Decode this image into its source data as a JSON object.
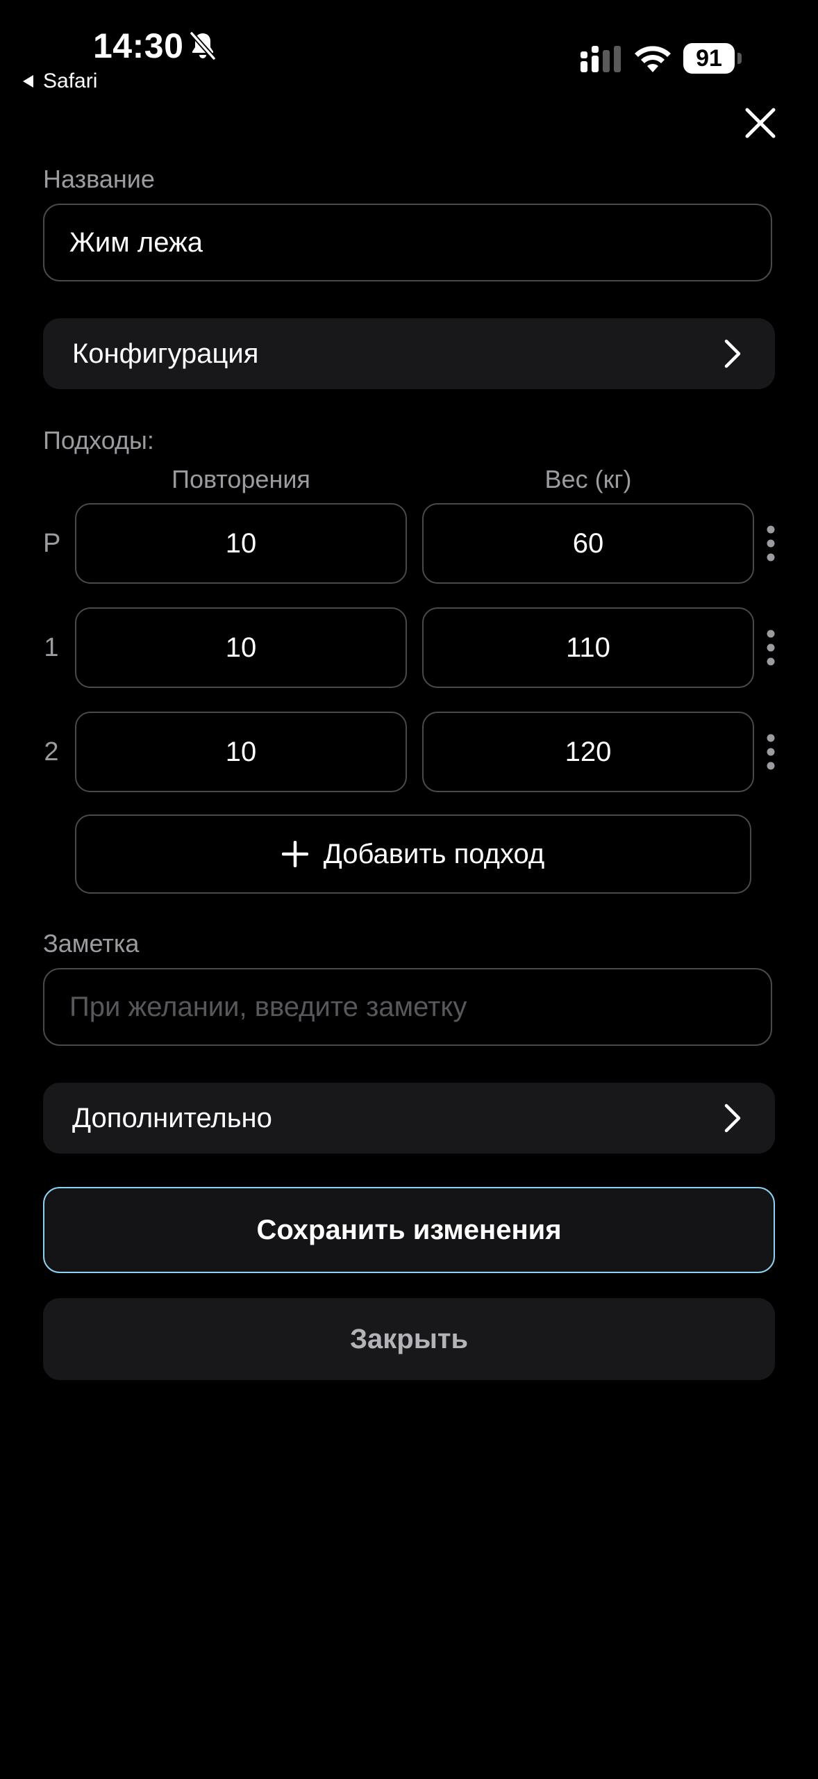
{
  "status_bar": {
    "time": "14:30",
    "back_app": "Safari",
    "battery": "91",
    "icons": [
      "bell-slash-icon",
      "cellular-signal-icon",
      "wifi-icon",
      "battery-icon"
    ]
  },
  "header": {
    "close_icon": "close-icon"
  },
  "form": {
    "name_label": "Название",
    "name_value": "Жим лежа",
    "configuration_label": "Конфигурация",
    "sets_label": "Подходы:",
    "columns": {
      "reps": "Повторения",
      "weight": "Вес (кг)"
    },
    "sets": [
      {
        "index": "Р",
        "reps": "10",
        "weight": "60"
      },
      {
        "index": "1",
        "reps": "10",
        "weight": "110"
      },
      {
        "index": "2",
        "reps": "10",
        "weight": "120"
      }
    ],
    "add_set_label": "Добавить подход",
    "note_label": "Заметка",
    "note_placeholder": "При желании, введите заметку",
    "note_value": "",
    "additional_label": "Дополнительно"
  },
  "actions": {
    "save_label": "Сохранить изменения",
    "close_label": "Закрыть"
  },
  "colors": {
    "background": "#000000",
    "surface": "#18181b",
    "border": "#4a4a4e",
    "accent_border": "#8fd1f0",
    "muted_text": "#9b9ba0"
  }
}
